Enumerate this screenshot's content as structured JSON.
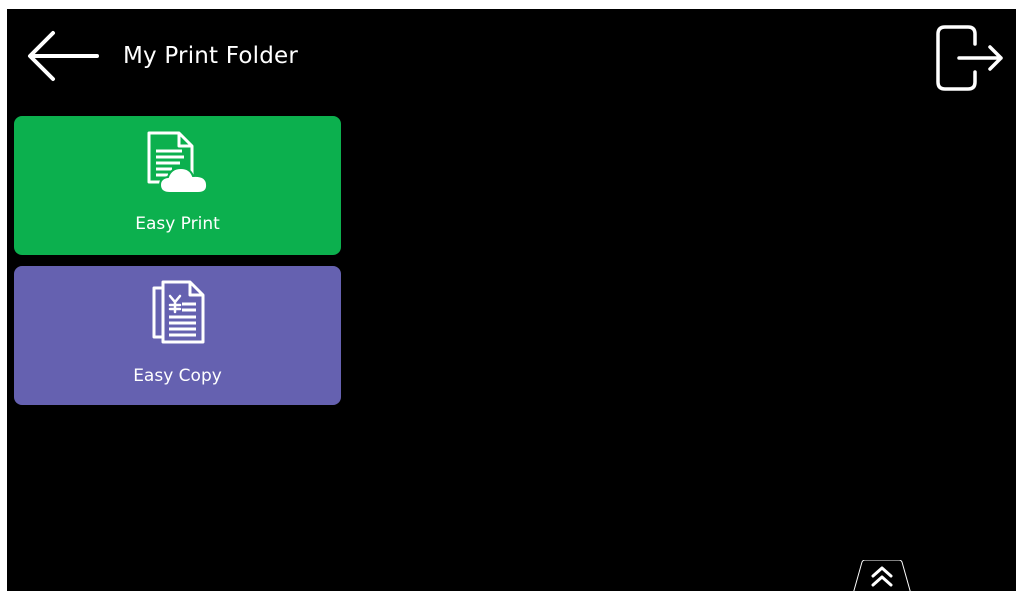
{
  "header": {
    "title": "My Print Folder",
    "back_icon": "arrow-left-icon",
    "logout_icon": "logout-icon"
  },
  "tiles": [
    {
      "label": "Easy Print",
      "icon": "document-cloud-icon",
      "color": "#0CB04E"
    },
    {
      "label": "Easy Copy",
      "icon": "copy-documents-icon",
      "color": "#6561B0"
    }
  ],
  "footer": {
    "scroll_icon": "double-chevron-up-icon"
  },
  "colors": {
    "background": "#000000",
    "text": "#FFFFFF"
  }
}
